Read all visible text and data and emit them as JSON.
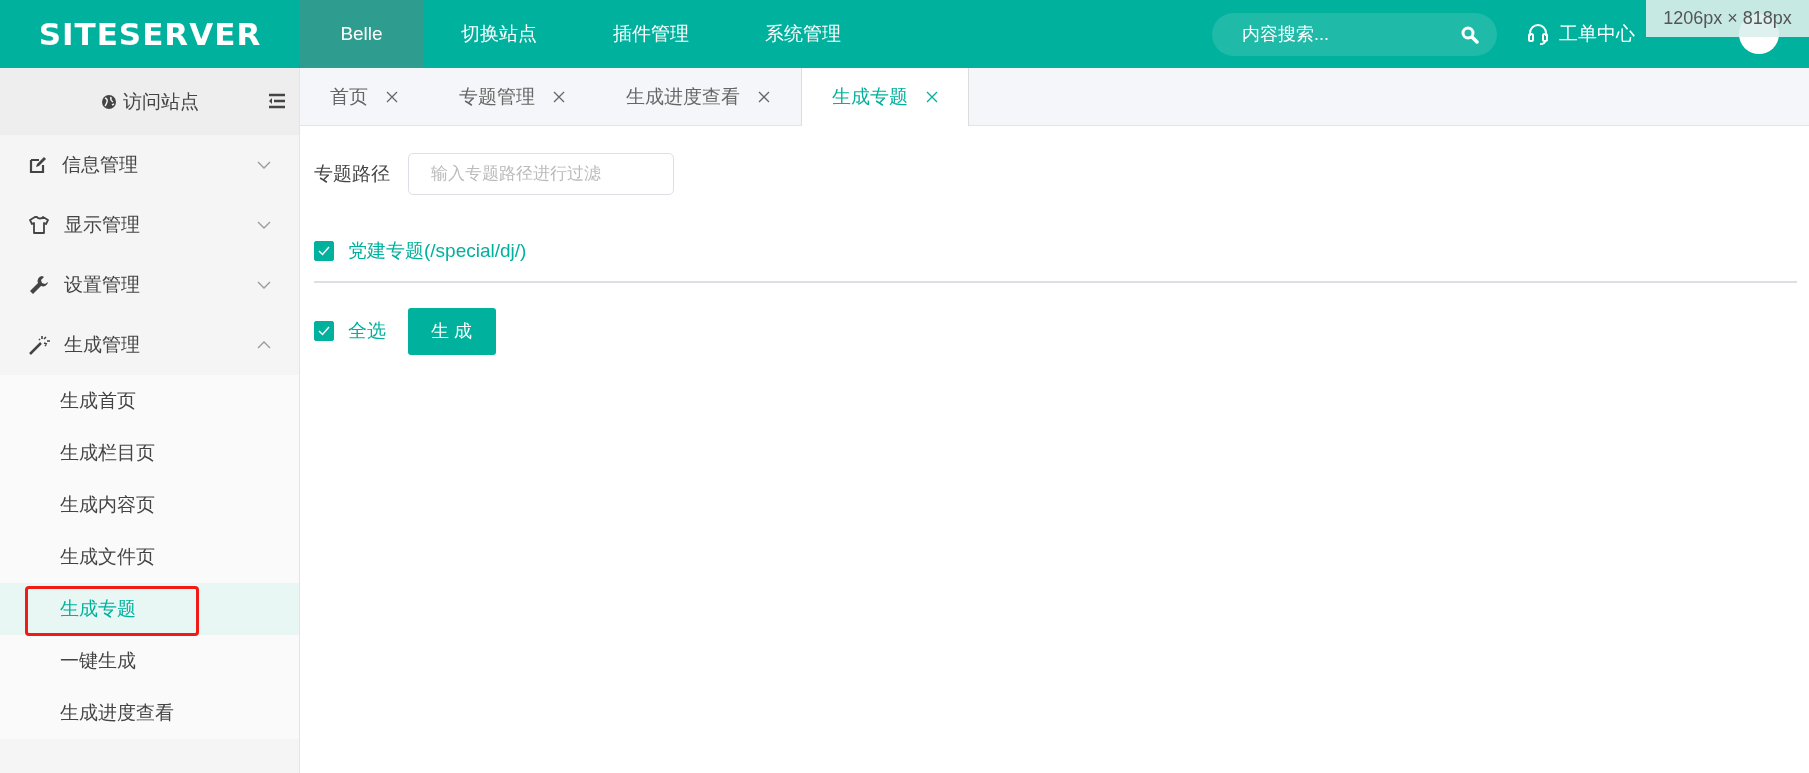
{
  "header": {
    "logo": "SITESERVER",
    "nav": [
      {
        "label": "Belle",
        "selected": true
      },
      {
        "label": "切换站点",
        "selected": false
      },
      {
        "label": "插件管理",
        "selected": false
      },
      {
        "label": "系统管理",
        "selected": false
      }
    ],
    "search": {
      "placeholder": "内容搜索..."
    },
    "support": "工单中心",
    "size_tooltip": "1206px × 818px"
  },
  "sidebar": {
    "visit_site": "访问站点",
    "menu": [
      {
        "label": "信息管理",
        "expanded": false
      },
      {
        "label": "显示管理",
        "expanded": false
      },
      {
        "label": "设置管理",
        "expanded": false
      },
      {
        "label": "生成管理",
        "expanded": true,
        "children": [
          {
            "label": "生成首页",
            "selected": false,
            "annotated": false
          },
          {
            "label": "生成栏目页",
            "selected": false,
            "annotated": false
          },
          {
            "label": "生成内容页",
            "selected": false,
            "annotated": false
          },
          {
            "label": "生成文件页",
            "selected": false,
            "annotated": false
          },
          {
            "label": "生成专题",
            "selected": true,
            "annotated": true
          },
          {
            "label": "一键生成",
            "selected": false,
            "annotated": false
          },
          {
            "label": "生成进度查看",
            "selected": false,
            "annotated": false
          }
        ]
      }
    ]
  },
  "tabs": [
    {
      "label": "首页",
      "selected": false
    },
    {
      "label": "专题管理",
      "selected": false
    },
    {
      "label": "生成进度查看",
      "selected": false
    },
    {
      "label": "生成专题",
      "selected": true
    }
  ],
  "filter": {
    "label": "专题路径",
    "placeholder": "输入专题路径进行过滤"
  },
  "specials": [
    {
      "label": "党建专题(/special/dj/)",
      "checked": true
    }
  ],
  "select_all": {
    "label": "全选",
    "checked": true
  },
  "generate_button": "生 成"
}
